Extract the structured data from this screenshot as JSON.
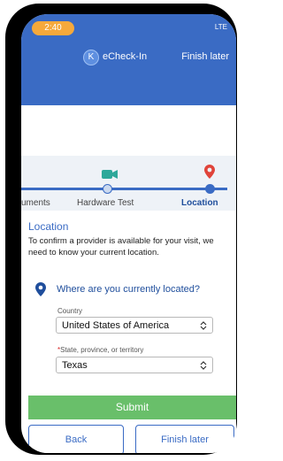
{
  "status_bar": {
    "time": "2:40",
    "right": "LTE"
  },
  "header": {
    "logo_letter": "K",
    "app_title": "eCheck-In",
    "finish_later": "Finish later"
  },
  "progress": {
    "steps": [
      {
        "label": "uments"
      },
      {
        "label": "Hardware Test",
        "icon": "camera-icon"
      },
      {
        "label": "Location",
        "icon": "pin-icon",
        "active": true
      }
    ]
  },
  "location": {
    "title": "Location",
    "description": "To confirm a provider is available for your visit, we need to know your current location.",
    "question": "Where are you currently located?",
    "country_label": "Country",
    "country_value": "United States of America",
    "state_required": "*",
    "state_label": "State, province, or territory",
    "state_value": "Texas"
  },
  "footer": {
    "submit": "Submit",
    "back": "Back",
    "finish_later": "Finish later"
  },
  "colors": {
    "primary": "#3a6bc4",
    "accent": "#f6a93b",
    "success": "#69bf6a",
    "alert": "#e0443a"
  }
}
